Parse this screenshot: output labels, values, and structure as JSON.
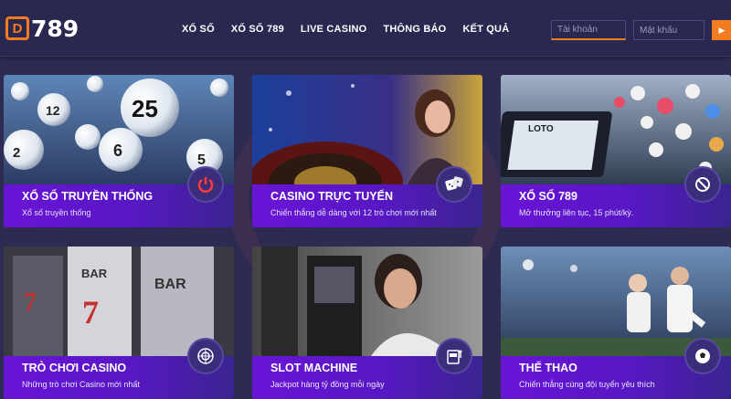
{
  "logo": {
    "box_letter": "D",
    "text": "789"
  },
  "nav": [
    {
      "label": "XỔ SỐ"
    },
    {
      "label": "XỔ SỐ 789"
    },
    {
      "label": "LIVE CASINO"
    },
    {
      "label": "THÔNG BÁO"
    },
    {
      "label": "KẾT QUẢ"
    }
  ],
  "login": {
    "username_placeholder": "Tài khoản",
    "password_placeholder": "Mật khẩu",
    "submit_icon": "arrow-right-icon"
  },
  "cards": [
    {
      "title": "XỔ SỐ TRUYỀN THỐNG",
      "subtitle": "Xổ số truyền thống",
      "icon": "power-icon"
    },
    {
      "title": "CASINO TRỰC TUYẾN",
      "subtitle": "Chiến thắng dễ dàng với 12 trò chơi mới nhất",
      "icon": "dice-icon"
    },
    {
      "title": "XỔ SỐ 789",
      "subtitle": "Mở thưởng liên tục, 15 phút/kỳ.",
      "icon": "lottery-icon"
    },
    {
      "title": "TRÒ CHƠI CASINO",
      "subtitle": "Những trò chơi Casino mới nhất",
      "icon": "roulette-icon"
    },
    {
      "title": "SLOT MACHINE",
      "subtitle": "Jackpot hàng tỷ đồng mỗi ngày",
      "icon": "slot-machine-icon"
    },
    {
      "title": "THỂ THAO",
      "subtitle": "Chiến thắng cùng đội tuyển yêu thích",
      "icon": "soccer-ball-icon"
    }
  ],
  "colors": {
    "accent": "#f47c20",
    "background": "#2e2b52",
    "card_band": "#6a14d6"
  }
}
